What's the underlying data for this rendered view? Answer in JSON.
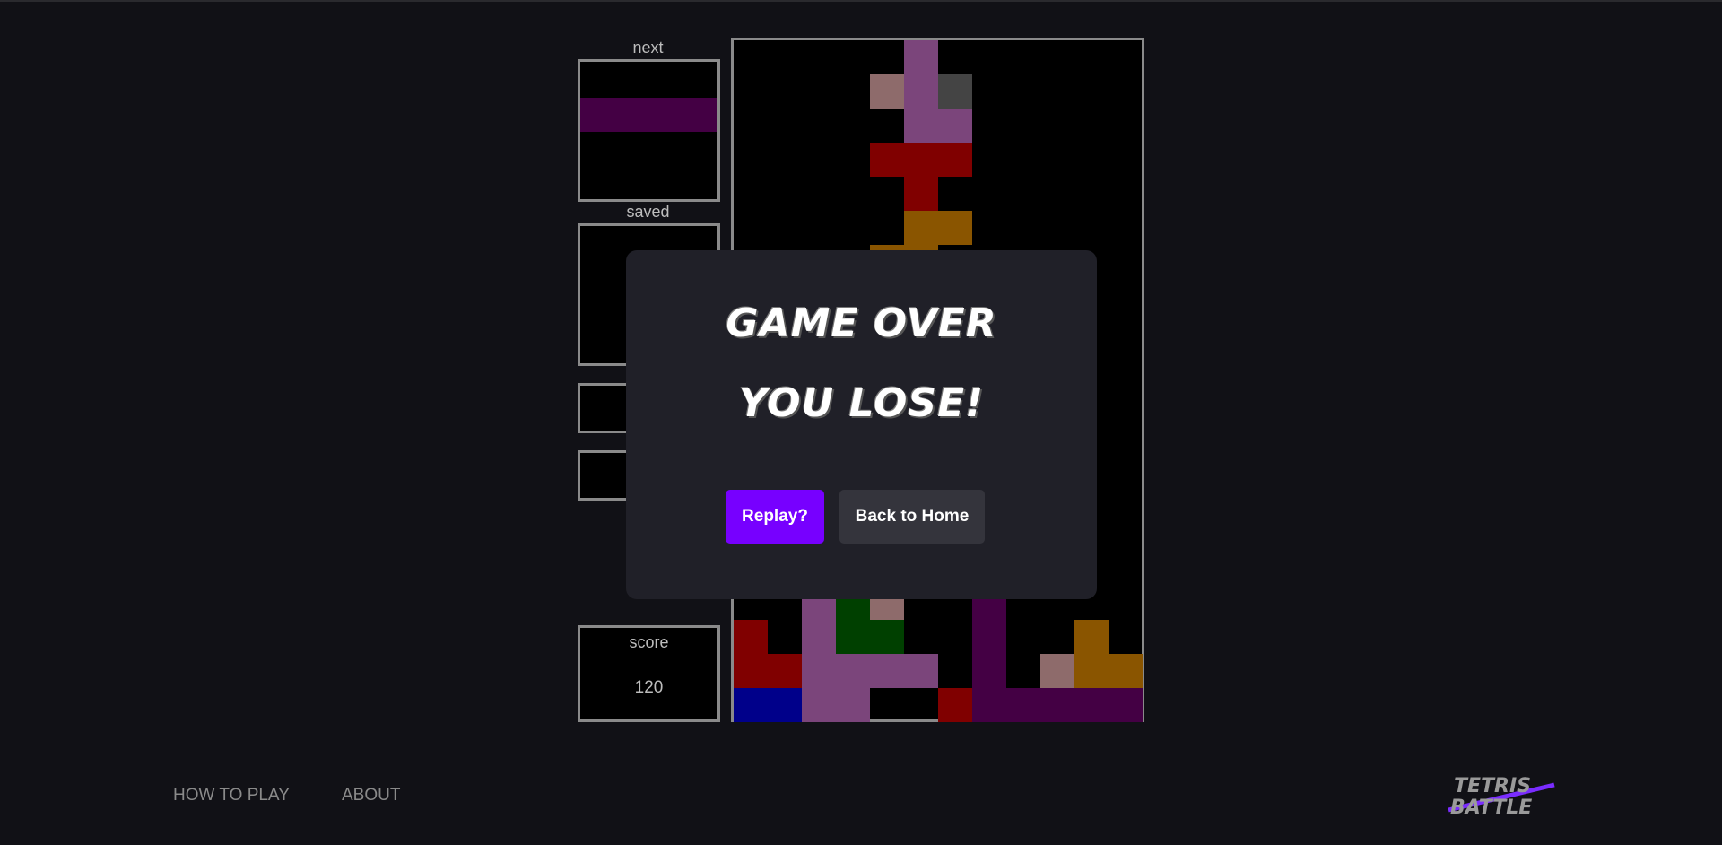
{
  "panels": {
    "next_label": "next",
    "saved_label": "saved",
    "score_label": "score",
    "score_value": "120"
  },
  "next_piece": {
    "color": "#440044"
  },
  "board_cells": [
    {
      "c": "#7b457b",
      "x": 5,
      "y": 0
    },
    {
      "c": "#8e6b6b",
      "x": 4,
      "y": 1
    },
    {
      "c": "#7b457b",
      "x": 5,
      "y": 1
    },
    {
      "c": "#444444",
      "x": 6,
      "y": 1
    },
    {
      "c": "#7b457b",
      "x": 5,
      "y": 2
    },
    {
      "c": "#7b457b",
      "x": 6,
      "y": 2
    },
    {
      "c": "#800000",
      "x": 4,
      "y": 3
    },
    {
      "c": "#800000",
      "x": 5,
      "y": 3
    },
    {
      "c": "#800000",
      "x": 6,
      "y": 3
    },
    {
      "c": "#800000",
      "x": 5,
      "y": 4
    },
    {
      "c": "#8a5500",
      "x": 5,
      "y": 5
    },
    {
      "c": "#8a5500",
      "x": 6,
      "y": 5
    },
    {
      "c": "#8a5500",
      "x": 4,
      "y": 6
    },
    {
      "c": "#8a5500",
      "x": 5,
      "y": 6
    },
    {
      "c": "#7b457b",
      "x": 2,
      "y": 16
    },
    {
      "c": "#004000",
      "x": 3,
      "y": 16
    },
    {
      "c": "#8e6b6b",
      "x": 4,
      "y": 16
    },
    {
      "c": "#440044",
      "x": 7,
      "y": 16
    },
    {
      "c": "#800000",
      "x": 0,
      "y": 17
    },
    {
      "c": "#7b457b",
      "x": 2,
      "y": 17
    },
    {
      "c": "#004000",
      "x": 3,
      "y": 17
    },
    {
      "c": "#004000",
      "x": 4,
      "y": 17
    },
    {
      "c": "#440044",
      "x": 7,
      "y": 17
    },
    {
      "c": "#8a5500",
      "x": 10,
      "y": 17
    },
    {
      "c": "#800000",
      "x": 0,
      "y": 18
    },
    {
      "c": "#800000",
      "x": 1,
      "y": 18
    },
    {
      "c": "#7b457b",
      "x": 2,
      "y": 18
    },
    {
      "c": "#7b457b",
      "x": 3,
      "y": 18
    },
    {
      "c": "#7b457b",
      "x": 4,
      "y": 18
    },
    {
      "c": "#7b457b",
      "x": 5,
      "y": 18
    },
    {
      "c": "#440044",
      "x": 7,
      "y": 18
    },
    {
      "c": "#8e6b6b",
      "x": 9,
      "y": 18
    },
    {
      "c": "#8a5500",
      "x": 10,
      "y": 18
    },
    {
      "c": "#8a5500",
      "x": 11,
      "y": 18
    },
    {
      "c": "#00008a",
      "x": 0,
      "y": 19
    },
    {
      "c": "#00008a",
      "x": 1,
      "y": 19
    },
    {
      "c": "#7b457b",
      "x": 2,
      "y": 19
    },
    {
      "c": "#7b457b",
      "x": 3,
      "y": 19
    },
    {
      "c": "#800000",
      "x": 6,
      "y": 19
    },
    {
      "c": "#440044",
      "x": 7,
      "y": 19
    },
    {
      "c": "#440044",
      "x": 8,
      "y": 19
    },
    {
      "c": "#440044",
      "x": 9,
      "y": 19
    },
    {
      "c": "#440044",
      "x": 10,
      "y": 19
    },
    {
      "c": "#440044",
      "x": 11,
      "y": 19
    }
  ],
  "dialog": {
    "title": "GAME OVER",
    "subtitle": "YOU LOSE!",
    "replay_label": "Replay?",
    "home_label": "Back to Home",
    "replay_color": "#7700ff",
    "home_color": "#34343c"
  },
  "footer": {
    "how_to_play": "HOW TO PLAY",
    "about": "ABOUT"
  },
  "logo": {
    "line1": "TETRIS",
    "line2": "BATTLE",
    "accent": "#7a2cff"
  }
}
